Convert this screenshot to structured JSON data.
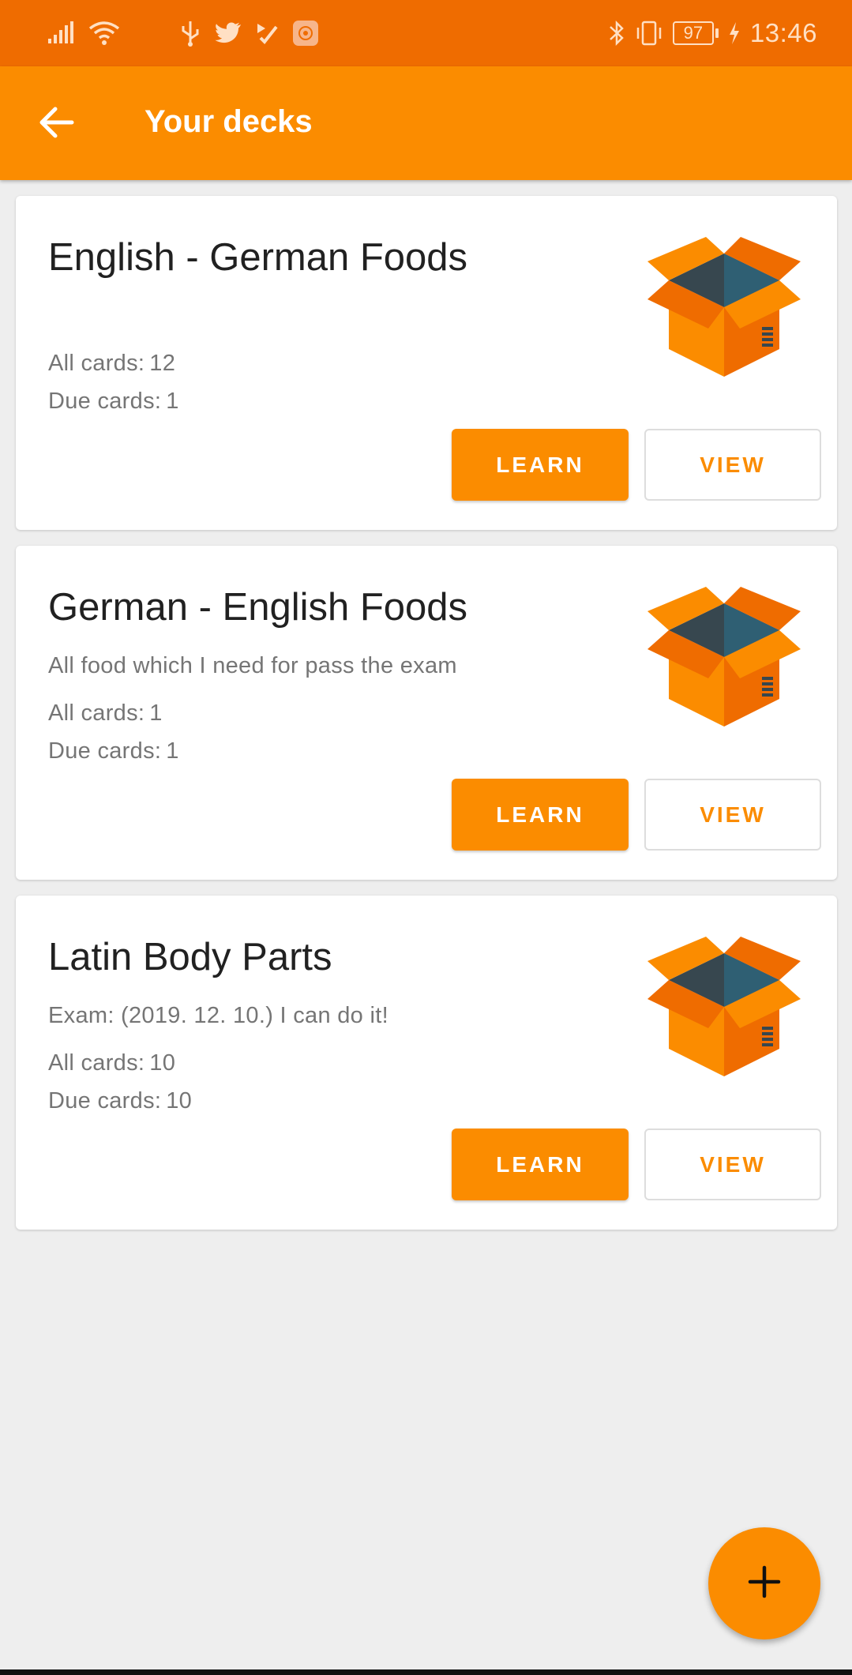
{
  "status_bar": {
    "time": "13:46",
    "battery": "97",
    "left_icons": [
      "signal-icon",
      "wifi-icon",
      "usb-icon",
      "twitter-icon",
      "tasks-icon",
      "app-badge-icon"
    ],
    "right_icons": [
      "bluetooth-icon",
      "vibrate-icon",
      "battery-icon",
      "charging-icon"
    ]
  },
  "app_bar": {
    "title": "Your decks",
    "back_icon": "arrow-back-icon"
  },
  "decks": [
    {
      "title": "English - German Foods",
      "description": "",
      "all_label": "All cards:",
      "all_count": "12",
      "due_label": "Due cards:",
      "due_count": "1",
      "learn_label": "LEARN",
      "view_label": "VIEW"
    },
    {
      "title": "German - English Foods",
      "description": "All food which I need for pass the exam",
      "all_label": "All cards:",
      "all_count": "1",
      "due_label": "Due cards:",
      "due_count": "1",
      "learn_label": "LEARN",
      "view_label": "VIEW"
    },
    {
      "title": "Latin Body Parts",
      "description": "Exam: (2019. 12. 10.) I can do it!",
      "all_label": "All cards:",
      "all_count": "10",
      "due_label": "Due cards:",
      "due_count": "10",
      "learn_label": "LEARN",
      "view_label": "VIEW"
    }
  ],
  "fab": {
    "icon": "plus-icon"
  },
  "colors": {
    "status_bar": "#ef6c00",
    "app_bar": "#fb8c00",
    "accent": "#fb8c00",
    "background": "#eeeeee",
    "card": "#ffffff",
    "box_dark": "#2f5f73"
  }
}
